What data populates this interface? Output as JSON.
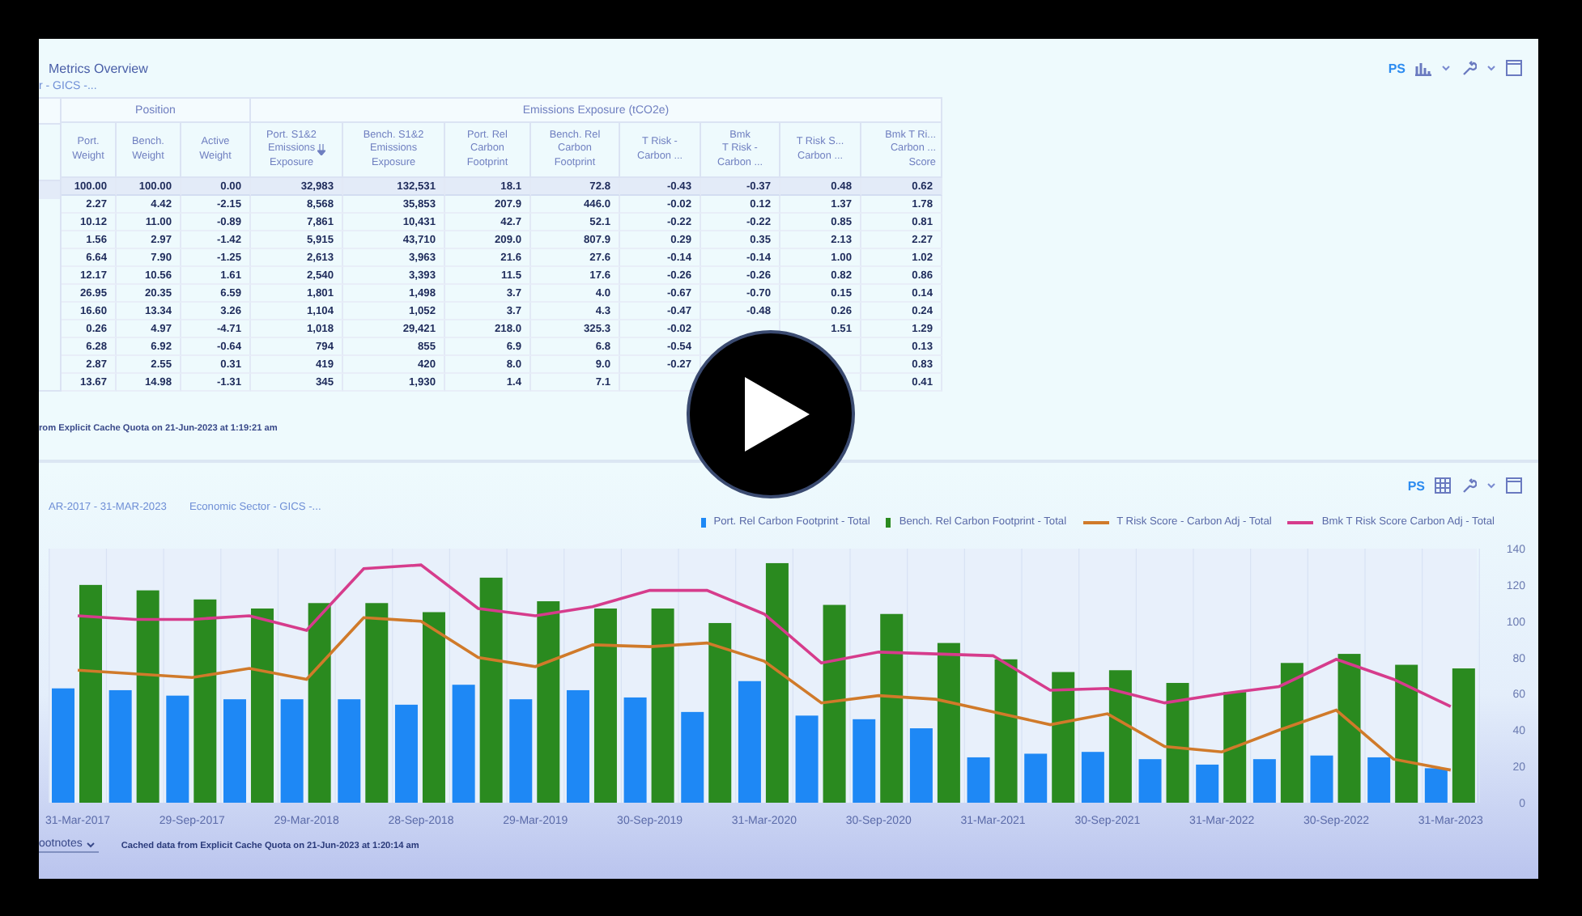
{
  "top_panel": {
    "title": "Metrics Overview",
    "breadcrumb": "r - GICS -...",
    "toolbar": {
      "badge": "PS"
    },
    "table": {
      "column_groups": [
        {
          "label": "Position",
          "columns": [
            {
              "label": "Port.\nWeight",
              "sorted": false
            },
            {
              "label": "Bench.\nWeight",
              "sorted": false
            },
            {
              "label": "Active\nWeight",
              "sorted": false
            }
          ]
        },
        {
          "label": "Emissions Exposure (tCO2e)",
          "columns": [
            {
              "label": "Port. S1&2\nEmissions\nExposure",
              "sorted": true
            },
            {
              "label": "Bench. S1&2\nEmissions\nExposure",
              "sorted": false
            },
            {
              "label": "Port. Rel\nCarbon\nFootprint",
              "sorted": false
            },
            {
              "label": "Bench. Rel\nCarbon\nFootprint",
              "sorted": false
            },
            {
              "label": "T Risk -\nCarbon ...",
              "sorted": false
            },
            {
              "label": "Bmk\nT Risk -\nCarbon ...",
              "sorted": false
            },
            {
              "label": "T Risk S...\nCarbon ...",
              "sorted": false
            },
            {
              "label": "Bmk T Ri...\nCarbon ...\nScore",
              "sorted": false
            }
          ]
        }
      ],
      "rows": [
        {
          "kind": "total",
          "cells": [
            "100.00",
            "100.00",
            "0.00",
            "32,983",
            "132,531",
            "18.1",
            "72.8",
            "-0.43",
            "-0.37",
            "0.48",
            "0.62"
          ]
        },
        {
          "kind": "row",
          "cells": [
            "2.27",
            "4.42",
            "-2.15",
            "8,568",
            "35,853",
            "207.9",
            "446.0",
            "-0.02",
            "0.12",
            "1.37",
            "1.78"
          ]
        },
        {
          "kind": "row",
          "cells": [
            "10.12",
            "11.00",
            "-0.89",
            "7,861",
            "10,431",
            "42.7",
            "52.1",
            "-0.22",
            "-0.22",
            "0.85",
            "0.81"
          ]
        },
        {
          "kind": "row",
          "cells": [
            "1.56",
            "2.97",
            "-1.42",
            "5,915",
            "43,710",
            "209.0",
            "807.9",
            "0.29",
            "0.35",
            "2.13",
            "2.27"
          ]
        },
        {
          "kind": "row",
          "cells": [
            "6.64",
            "7.90",
            "-1.25",
            "2,613",
            "3,963",
            "21.6",
            "27.6",
            "-0.14",
            "-0.14",
            "1.00",
            "1.02"
          ]
        },
        {
          "kind": "row",
          "cells": [
            "12.17",
            "10.56",
            "1.61",
            "2,540",
            "3,393",
            "11.5",
            "17.6",
            "-0.26",
            "-0.26",
            "0.82",
            "0.86"
          ]
        },
        {
          "kind": "row",
          "cells": [
            "26.95",
            "20.35",
            "6.59",
            "1,801",
            "1,498",
            "3.7",
            "4.0",
            "-0.67",
            "-0.70",
            "0.15",
            "0.14"
          ]
        },
        {
          "kind": "row",
          "cells": [
            "16.60",
            "13.34",
            "3.26",
            "1,104",
            "1,052",
            "3.7",
            "4.3",
            "-0.47",
            "-0.48",
            "0.26",
            "0.24"
          ]
        },
        {
          "kind": "row",
          "cells": [
            "0.26",
            "4.97",
            "-4.71",
            "1,018",
            "29,421",
            "218.0",
            "325.3",
            "-0.02",
            null,
            "1.51",
            "1.29"
          ]
        },
        {
          "kind": "row",
          "cells": [
            "6.28",
            "6.92",
            "-0.64",
            "794",
            "855",
            "6.9",
            "6.8",
            "-0.54",
            null,
            null,
            "0.13"
          ]
        },
        {
          "kind": "row",
          "cells": [
            "2.87",
            "2.55",
            "0.31",
            "419",
            "420",
            "8.0",
            "9.0",
            "-0.27",
            null,
            null,
            "0.83"
          ]
        },
        {
          "kind": "row",
          "cells": [
            "13.67",
            "14.98",
            "-1.31",
            "345",
            "1,930",
            "1.4",
            "7.1",
            null,
            null,
            null,
            "0.41"
          ]
        }
      ]
    },
    "footer": "rom Explicit Cache Quota on 21-Jun-2023 at 1:19:21 am"
  },
  "bottom_panel": {
    "toolbar": {
      "badge": "PS"
    },
    "period": "AR-2017 - 31-MAR-2023",
    "breadcrumb": "Economic Sector - GICS -...",
    "chart_data": {
      "type": "bar",
      "ylim": [
        0,
        140
      ],
      "yticks": [
        0,
        20,
        40,
        60,
        80,
        100,
        120,
        140
      ],
      "categories": [
        "31-Mar-2017",
        null,
        "29-Sep-2017",
        null,
        "29-Mar-2018",
        null,
        "28-Sep-2018",
        null,
        "29-Mar-2019",
        null,
        "30-Sep-2019",
        null,
        "31-Mar-2020",
        null,
        "30-Sep-2020",
        null,
        "31-Mar-2021",
        null,
        "30-Sep-2021",
        null,
        "31-Mar-2022",
        null,
        "30-Sep-2022",
        null,
        "31-Mar-2023"
      ],
      "series": [
        {
          "name": "Port. Rel Carbon Footprint - Total",
          "type": "bar",
          "color": "#1e88f5",
          "values": [
            63,
            62,
            59,
            57,
            57,
            57,
            54,
            65,
            57,
            62,
            58,
            50,
            67,
            48,
            46,
            41,
            25,
            27,
            28,
            24,
            21,
            24,
            26,
            25,
            19
          ]
        },
        {
          "name": "Bench. Rel Carbon Footprint - Total",
          "type": "bar",
          "color": "#2a8a1f",
          "values": [
            120,
            117,
            112,
            107,
            110,
            110,
            105,
            124,
            111,
            107,
            107,
            99,
            132,
            109,
            104,
            88,
            79,
            72,
            73,
            66,
            61,
            77,
            82,
            76,
            74
          ]
        },
        {
          "name": "T Risk Score -  Carbon Adj - Total",
          "type": "line",
          "color": "#d07a2a",
          "values": [
            73,
            71,
            69,
            74,
            68,
            102,
            100,
            80,
            75,
            87,
            86,
            88,
            78,
            55,
            59,
            57,
            50,
            43,
            49,
            31,
            28,
            40,
            51,
            24,
            18
          ]
        },
        {
          "name": "Bmk T Risk Score Carbon Adj - Total",
          "type": "line",
          "color": "#d63c8c",
          "values": [
            103,
            101,
            101,
            103,
            95,
            129,
            131,
            107,
            103,
            108,
            117,
            117,
            104,
            77,
            83,
            82,
            81,
            62,
            63,
            55,
            60,
            64,
            79,
            68,
            53
          ]
        }
      ]
    },
    "footnotes": "ootnotes",
    "footer": "Cached data from Explicit Cache Quota on 21-Jun-2023 at 1:20:14 am"
  }
}
